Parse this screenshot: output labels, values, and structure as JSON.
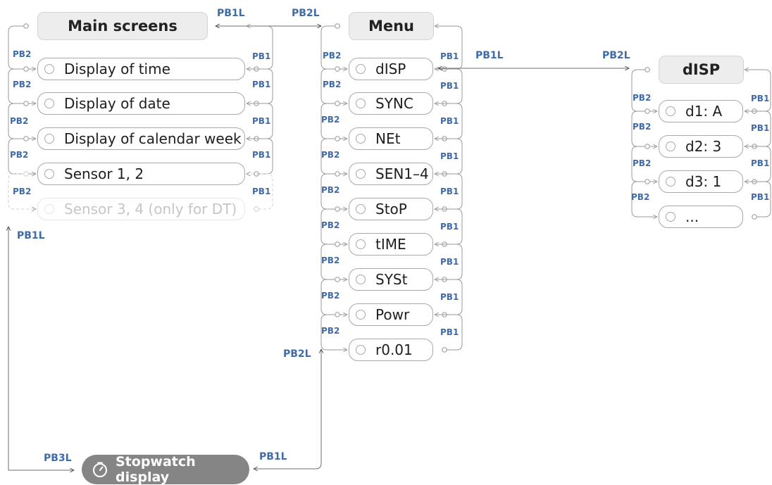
{
  "main_screens": {
    "title": "Main screens",
    "items": [
      "Display of time",
      "Display of date",
      "Display of calendar week",
      "Sensor 1, 2",
      "Sensor 3, 4 (only for DT)"
    ]
  },
  "menu": {
    "title": "Menu",
    "items": [
      "dISP",
      "SYNC",
      "NEt",
      "SEN1–4",
      "StoP",
      "tIME",
      "SYSt",
      "Powr",
      "r0.01"
    ]
  },
  "disp": {
    "title": "dISP",
    "items": [
      "d1: A",
      "d2: 3",
      "d3: 1",
      "..."
    ]
  },
  "stopwatch": {
    "label": "Stopwatch display",
    "icon": "stopwatch-icon"
  },
  "labels": {
    "pb1": "PB1",
    "pb2": "PB2",
    "pb1l": "PB1L",
    "pb2l": "PB2L",
    "pb3l": "PB3L"
  },
  "colors": {
    "label": "#3f6ba8",
    "header_fill": "#ededed",
    "outline": "#a9a9a9",
    "stopwatch_fill": "#858585"
  }
}
